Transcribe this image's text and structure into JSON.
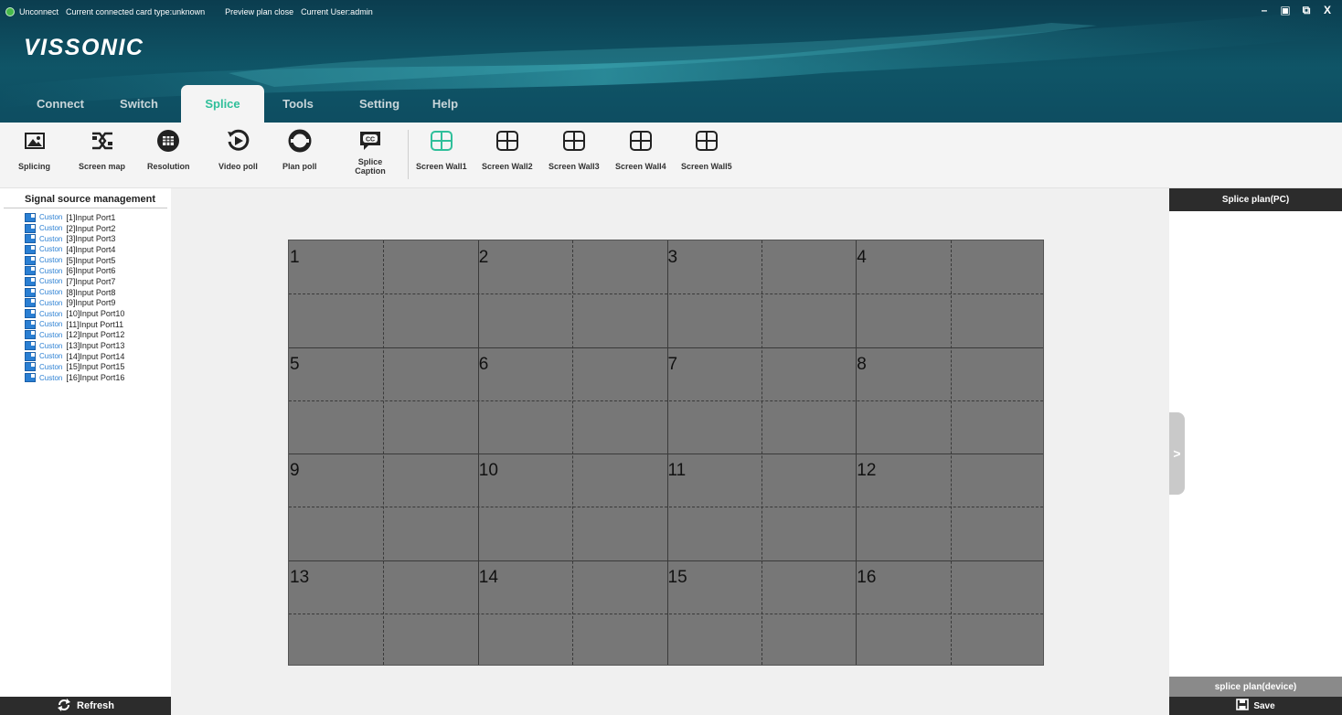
{
  "status": {
    "connection": "Unconnect",
    "card_type": "Current connected card type:unknown",
    "preview": "Preview plan close",
    "user": "Current User:admin"
  },
  "logo": "VISSONIC",
  "window_controls": {
    "minimize": "–",
    "restore": "▣",
    "popout": "⧉",
    "close": "X"
  },
  "tabs": [
    {
      "label": "Connect"
    },
    {
      "label": "Switch"
    },
    {
      "label": "Splice",
      "active": true
    },
    {
      "label": "Tools"
    },
    {
      "label": "Setting"
    },
    {
      "label": "Help"
    }
  ],
  "toolbar": {
    "splicing": "Splicing",
    "screen_map": "Screen map",
    "resolution": "Resolution",
    "video_poll": "Video poll",
    "plan_poll": "Plan poll",
    "splice_caption": "Splice Caption",
    "walls": [
      "Screen Wall1",
      "Screen Wall2",
      "Screen Wall3",
      "Screen Wall4",
      "Screen Wall5"
    ],
    "accent_color": "#2fbf9a"
  },
  "left_panel": {
    "title": "Signal source management",
    "sources": [
      {
        "type": "Custon",
        "name": "[1]Input Port1"
      },
      {
        "type": "Custon",
        "name": "[2]Input Port2"
      },
      {
        "type": "Custon",
        "name": "[3]Input Port3"
      },
      {
        "type": "Custon",
        "name": "[4]Input Port4"
      },
      {
        "type": "Custon",
        "name": "[5]Input Port5"
      },
      {
        "type": "Custon",
        "name": "[6]Input Port6"
      },
      {
        "type": "Custon",
        "name": "[7]Input Port7"
      },
      {
        "type": "Custon",
        "name": "[8]Input Port8"
      },
      {
        "type": "Custon",
        "name": "[9]Input Port9"
      },
      {
        "type": "Custon",
        "name": "[10]Input Port10"
      },
      {
        "type": "Custon",
        "name": "[11]Input Port11"
      },
      {
        "type": "Custon",
        "name": "[12]Input Port12"
      },
      {
        "type": "Custon",
        "name": "[13]Input Port13"
      },
      {
        "type": "Custon",
        "name": "[14]Input Port14"
      },
      {
        "type": "Custon",
        "name": "[15]Input Port15"
      },
      {
        "type": "Custon",
        "name": "[16]Input Port16"
      }
    ],
    "refresh": "Refresh"
  },
  "wall": {
    "screens": [
      "1",
      "2",
      "3",
      "4",
      "5",
      "6",
      "7",
      "8",
      "9",
      "10",
      "11",
      "12",
      "13",
      "14",
      "15",
      "16"
    ],
    "columns": 4,
    "rows": 4
  },
  "right_panel": {
    "title": "Splice plan(PC)",
    "device": "splice plan(device)",
    "save": "Save",
    "toggle": ">"
  }
}
